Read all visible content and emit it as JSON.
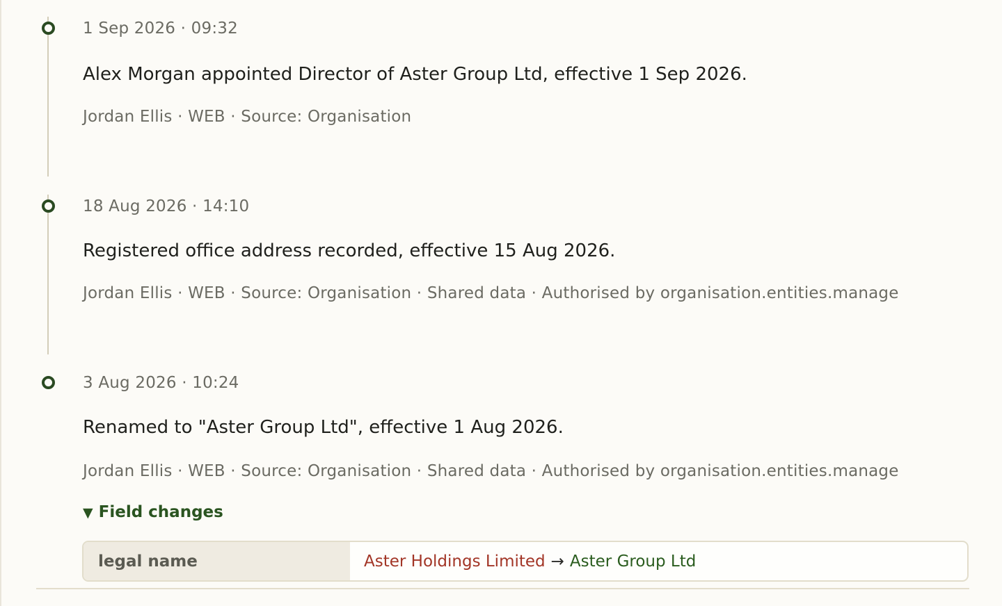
{
  "events": [
    {
      "time": "1 Sep 2026 · 09:32",
      "summary": "Alex Morgan appointed Director of Aster Group Ltd, effective 1 Sep 2026.",
      "meta": "Jordan Ellis · WEB · Source: Organisation"
    },
    {
      "time": "18 Aug 2026 · 14:10",
      "summary": "Registered office address recorded, effective 15 Aug 2026.",
      "meta": "Jordan Ellis · WEB · Source: Organisation · Shared data · Authorised by organisation.entities.manage"
    },
    {
      "time": "3 Aug 2026 · 10:24",
      "summary": "Renamed to \"Aster Group Ltd\", effective 1 Aug 2026.",
      "meta": "Jordan Ellis · WEB · Source: Organisation · Shared data · Authorised by organisation.entities.manage"
    }
  ],
  "field_changes": {
    "toggle_label": "Field changes",
    "toggle_glyph": "▼",
    "rows": [
      {
        "field": "legal name",
        "old_value": "Aster Holdings Limited",
        "arrow": "→",
        "new_value": "Aster Group Ltd"
      }
    ]
  },
  "colors": {
    "accent_green": "#2a5420",
    "old_value_red": "#a23526",
    "timeline_rail": "#d3cdb9"
  }
}
